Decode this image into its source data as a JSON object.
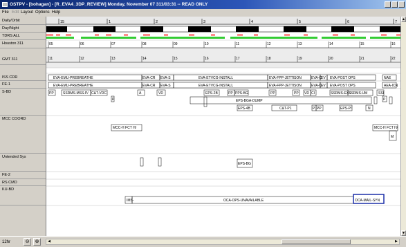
{
  "window": {
    "title": "OSTPV - [bohagan] - [R_EVA4_3DP_REVIEW] Monday, November 07 311/03:31  -- READ ONLY"
  },
  "menu": [
    "File",
    "Edit",
    "Layout",
    "Options",
    "Help"
  ],
  "rows": [
    {
      "label": "Daily/Orbit"
    },
    {
      "label": "Day/Night"
    },
    {
      "label": "TDRS ALL"
    },
    {
      "label": "Houston 311"
    },
    {
      "label": "GMT 311"
    },
    {
      "label": "ISS CDR"
    },
    {
      "label": "FE-1"
    },
    {
      "label": "S-BD"
    },
    {
      "label": "MCC COORD"
    },
    {
      "label": "Untended Sys"
    },
    {
      "label": "FE-2"
    },
    {
      "label": "RS CMD"
    },
    {
      "label": "KU-BD"
    }
  ],
  "orbit_numbers": [
    "15",
    "1",
    "2",
    "3",
    "4",
    "5",
    "6",
    "7"
  ],
  "houston_hours": [
    "05",
    "06",
    "07",
    "08",
    "09",
    "10",
    "11",
    "12",
    "13",
    "14",
    "15",
    "16"
  ],
  "gmt_hours": [
    "11",
    "12",
    "13",
    "14",
    "15",
    "16",
    "17",
    "18",
    "19",
    "20",
    "21",
    "22"
  ],
  "activities": {
    "iss_cdr": [
      "EVA-EMU-PREBREATHE",
      "EVA-CR",
      "EVA-S",
      "EVA-ETVCG-INSTALL",
      "EVA-FPP-JETTISON",
      "EVA-C",
      "EV",
      "EVA-POST OPS",
      "NAE"
    ],
    "fe1": [
      "EVA-EMU-PREBREATHE",
      "EVA-CR",
      "EVA-S",
      "EVA-ETVCG-INSTALL",
      "EVA-FPP-JETTISON",
      "EVA-C",
      "EV",
      "EVA-POST OPS",
      "AEA-ICN"
    ],
    "sbd": [
      "PP",
      "SSRMS-MSS-P/",
      "C&T-VDC",
      "A",
      "VD",
      "EPS-2B",
      "PP",
      "PPS-BG",
      "PP",
      "PP",
      "VD",
      "CI",
      "SSRMS-EXS",
      "SSRMS-UM",
      "SSI",
      "P",
      "P",
      "EPS-BGA-DUMP",
      "EPS-4B",
      "C&T-P1",
      "P",
      "PP",
      "EPS-P/",
      "N"
    ],
    "mcc": [
      "MCC-H FCT H/",
      "MCC-H FCT H/",
      "M"
    ],
    "untended": [
      "EPS-BG"
    ],
    "kubd": [
      "IMS-",
      "OCA-OPS-UNAVAILABLE",
      "OCA-MAIL-SYN"
    ]
  },
  "status": {
    "zoom": "12hr",
    "zoom_out_icon": "zoom-out-icon",
    "zoom_in_icon": "zoom-in-icon"
  }
}
